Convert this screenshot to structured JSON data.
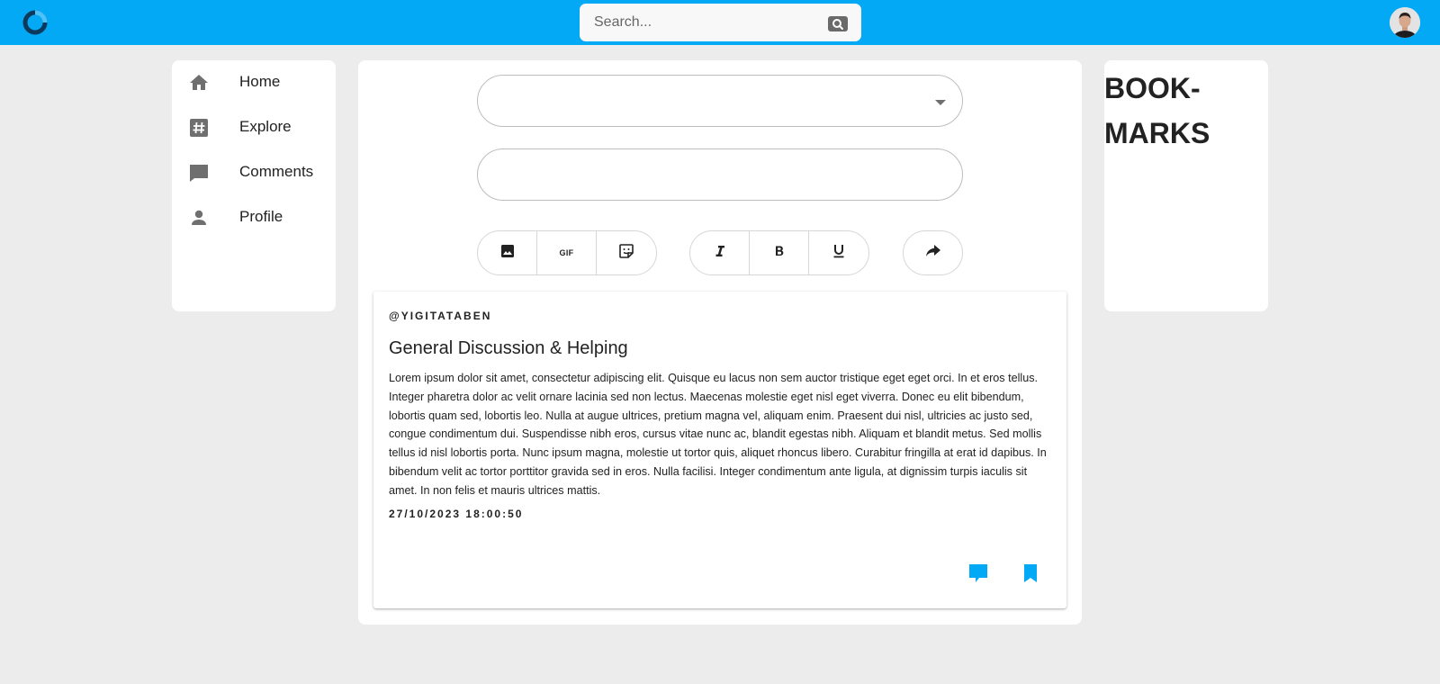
{
  "colors": {
    "accent": "#03a9f4",
    "background": "#ececec",
    "card": "#ffffff",
    "icon_grey": "#6f6f6f"
  },
  "header": {
    "logo_icon": "ring-logo-icon",
    "search": {
      "placeholder": "Search...",
      "button_icon": "search-icon"
    },
    "avatar_icon": "user-avatar"
  },
  "sidebar": {
    "items": [
      {
        "label": "Home",
        "icon": "home-icon"
      },
      {
        "label": "Explore",
        "icon": "hashtag-icon"
      },
      {
        "label": "Comments",
        "icon": "comment-icon"
      },
      {
        "label": "Profile",
        "icon": "person-icon"
      }
    ]
  },
  "composer": {
    "select_value": "",
    "text_value": "",
    "media_buttons": [
      {
        "icon": "image-icon"
      },
      {
        "icon": "gif-icon",
        "label": "GIF"
      },
      {
        "icon": "sticker-icon"
      }
    ],
    "format_buttons": [
      {
        "icon": "italic-icon"
      },
      {
        "icon": "bold-icon"
      },
      {
        "icon": "underline-icon"
      }
    ],
    "send_icon": "share-arrow-icon"
  },
  "post": {
    "author": "@YIGITATABEN",
    "title": "General Discussion & Helping",
    "body": "Lorem ipsum dolor sit amet, consectetur adipiscing elit. Quisque eu lacus non sem auctor tristique eget eget orci. In et eros tellus. Integer pharetra dolor ac velit ornare lacinia sed non lectus. Maecenas molestie eget nisl eget viverra. Donec eu elit bibendum, lobortis quam sed, lobortis leo. Nulla at augue ultrices, pretium magna vel, aliquam enim. Praesent dui nisl, ultricies ac justo sed, congue condimentum dui. Suspendisse nibh eros, cursus vitae nunc ac, blandit egestas nibh. Aliquam et blandit metus. Sed mollis tellus id nisl lobortis porta. Nunc ipsum magna, molestie ut tortor quis, aliquet rhoncus libero. Curabitur fringilla at erat id dapibus. In bibendum velit ac tortor porttitor gravida sed in eros. Nulla facilisi. Integer condimentum ante ligula, at dignissim turpis iaculis sit amet. In non felis et mauris ultrices mattis.",
    "date": "27/10/2023 18:00:50",
    "actions": [
      {
        "icon": "comment-icon"
      },
      {
        "icon": "bookmark-icon"
      }
    ]
  },
  "bookmarks": {
    "title": "BOOK-\nMARKS"
  }
}
